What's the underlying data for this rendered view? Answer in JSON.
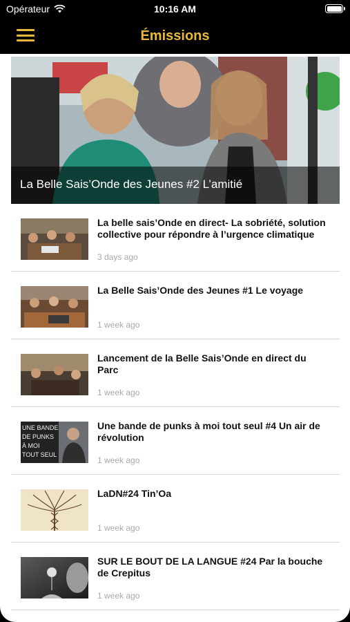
{
  "status_bar": {
    "carrier": "Opérateur",
    "time": "10:16 AM"
  },
  "nav": {
    "title": "Émissions"
  },
  "featured": {
    "title": "La Belle Sais’Onde des Jeunes #2 L’amitié"
  },
  "items": [
    {
      "title": "La belle sais’Onde en direct- La sobriété, solution collective pour répondre à l’urgence climatique",
      "date": "3 days ago"
    },
    {
      "title": "La Belle Sais’Onde des Jeunes #1 Le voyage",
      "date": "1 week ago"
    },
    {
      "title": "Lancement de la Belle Sais’Onde en direct du Parc",
      "date": "1 week ago"
    },
    {
      "title": "Une bande de punks à moi tout seul #4 Un air de révolution",
      "date": "1 week ago",
      "thumb_text": "UNE BANDE DE PUNKS À MOI TOUT SEUL"
    },
    {
      "title": "LaDN#24 Tin’Oa",
      "date": "1 week ago"
    },
    {
      "title": "SUR LE BOUT DE LA LANGUE #24 Par la bouche de Crepitus",
      "date": "1 week ago"
    }
  ],
  "colors": {
    "accent": "#e8b93a",
    "nav_bg": "#000000",
    "date": "#a9a9a9"
  }
}
